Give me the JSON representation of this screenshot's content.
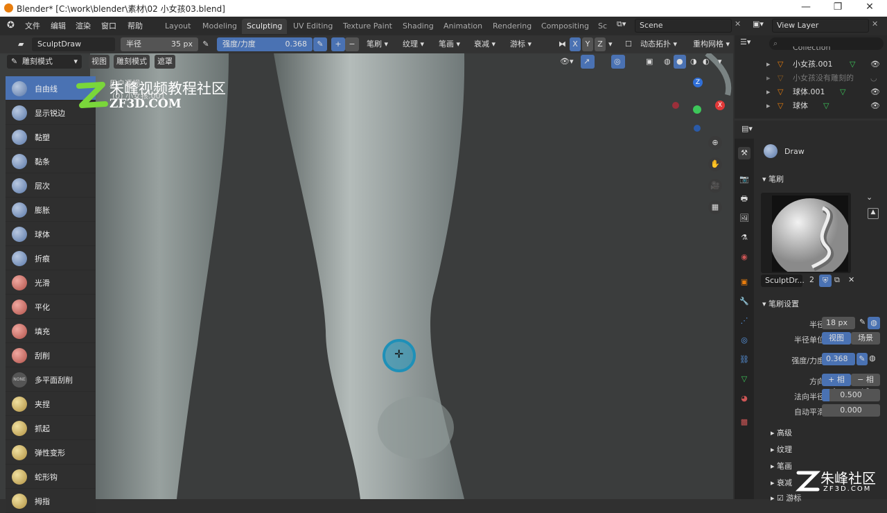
{
  "window": {
    "title": "Blender* [C:\\work\\blender\\素材\\02 小女孩03.blend]",
    "minimize": "—",
    "maximize": "❐",
    "close": "✕"
  },
  "menu": [
    "文件",
    "编辑",
    "渲染",
    "窗口",
    "帮助"
  ],
  "workspaces": [
    "Layout",
    "Modeling",
    "Sculpting",
    "UV Editing",
    "Texture Paint",
    "Shading",
    "Animation",
    "Rendering",
    "Compositing",
    "Sc"
  ],
  "active_workspace": "Sculpting",
  "scene": "Scene",
  "view_layer": "View Layer",
  "tool_header": {
    "brush_name": "SculptDraw",
    "radius_label": "半径",
    "radius_value": "35 px",
    "strength_label": "强度/力度",
    "strength_value": "0.368",
    "plus": "+",
    "minus": "−",
    "menus": [
      "笔刷",
      "纹理",
      "笔画",
      "衰减",
      "游标"
    ],
    "x": "X",
    "y": "Y",
    "z": "Z",
    "dyntopo": "动态拓扑",
    "remesh": "重构网格"
  },
  "viewport": {
    "mode": "雕刻模式",
    "buttons": [
      "视图",
      "雕刻模式",
      "遮罩"
    ],
    "overlay_text": "用户透视",
    "overlay_object": "(0) 小女孩.001",
    "gizmo": {
      "x": "X",
      "y": "Y",
      "z": "Z"
    }
  },
  "tools": [
    "自由线",
    "显示锐边",
    "黏塑",
    "黏条",
    "层次",
    "膨胀",
    "球体",
    "折痕",
    "光滑",
    "平化",
    "填充",
    "刮削",
    "多平面刮削",
    "夹捏",
    "抓起",
    "弹性变形",
    "蛇形钩",
    "拇指"
  ],
  "active_tool": "自由线",
  "watermark": {
    "cn": "朱峰视频教程社区",
    "en": "ZF3D.COM",
    "cn2": "朱峰社区",
    "en2": "ZF3D.COM"
  },
  "outliner": {
    "items": [
      {
        "label": "Collection",
        "type": "collection"
      },
      {
        "label": "小女孩.001",
        "type": "mesh"
      },
      {
        "label": "小女孩没有雕刻的",
        "type": "mesh-disabled"
      },
      {
        "label": "球体.001",
        "type": "mesh"
      },
      {
        "label": "球体",
        "type": "mesh"
      }
    ]
  },
  "properties": {
    "brush_title": "Draw",
    "brush_section": "笔刷",
    "brush_preview_name": "SculptDr...",
    "brush_users": "2",
    "brush_settings_section": "笔刷设置",
    "radius_label": "半径",
    "radius_value": "18 px",
    "radius_unit_label": "半径单位",
    "radius_unit_options": [
      "视图",
      "场景"
    ],
    "radius_unit_selected": "视图",
    "strength_label": "强度/力度",
    "strength_value": "0.368",
    "direction_label": "方向",
    "direction_options": [
      "+ 相加",
      "− 相减"
    ],
    "normal_radius_label": "法向半径",
    "normal_radius_value": "0.500",
    "normal_radius_fill": 0.5,
    "autosmooth_label": "自动平滑",
    "autosmooth_value": "0.000",
    "subsections": [
      "高级",
      "纹理",
      "笔画",
      "衰减",
      "游标"
    ]
  },
  "colors": {
    "accent": "#4a72b3",
    "header": "#2b2b2b",
    "panel": "#303030",
    "viewport": "#3b3d3d",
    "orange": "#e87d0d",
    "green": "#3dc75a"
  }
}
